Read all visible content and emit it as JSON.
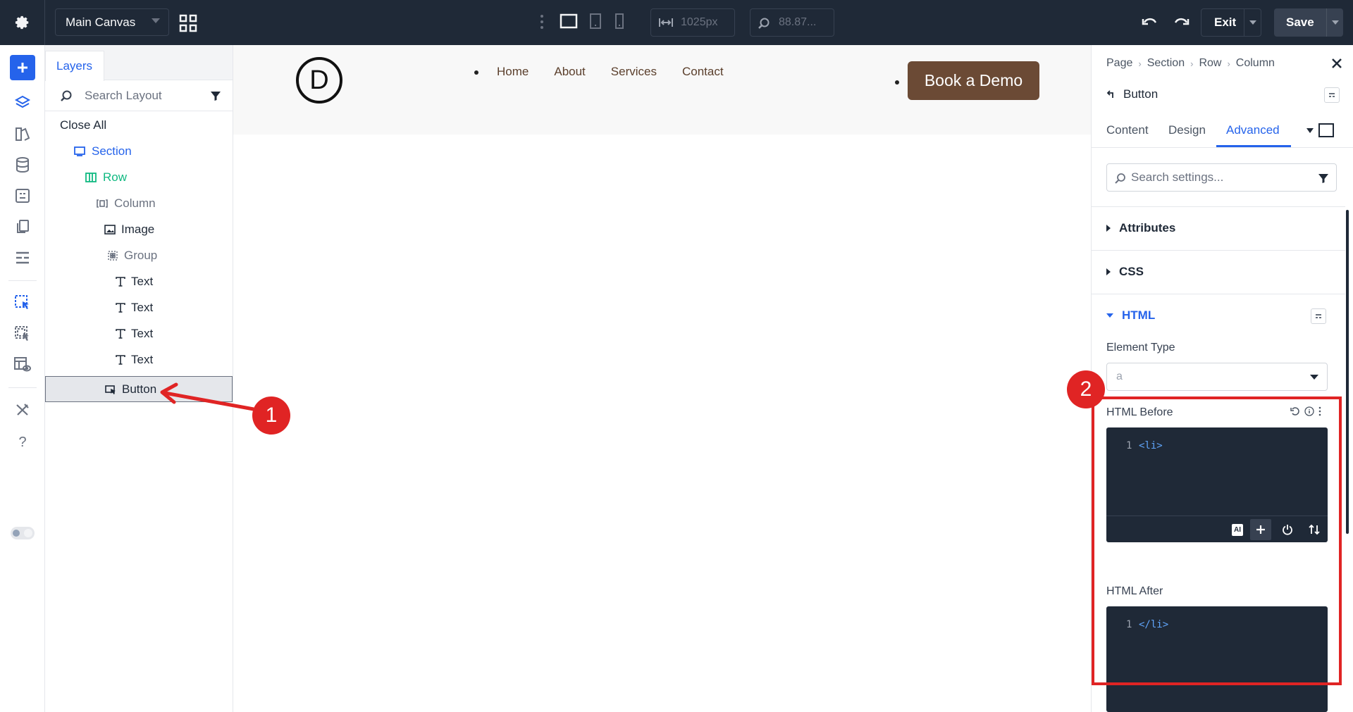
{
  "topbar": {
    "canvas_name": "Main Canvas",
    "width_value": "1025px",
    "zoom_value": "88.87...",
    "exit_label": "Exit",
    "save_label": "Save"
  },
  "layers": {
    "tab_label": "Layers",
    "search_placeholder": "Search Layout",
    "close_all": "Close All",
    "items": [
      {
        "label": "Section",
        "icon": "section-icon"
      },
      {
        "label": "Row",
        "icon": "row-icon"
      },
      {
        "label": "Column",
        "icon": "column-icon"
      },
      {
        "label": "Image",
        "icon": "image-icon"
      },
      {
        "label": "Group",
        "icon": "group-icon"
      },
      {
        "label": "Text",
        "icon": "text-icon"
      },
      {
        "label": "Text",
        "icon": "text-icon"
      },
      {
        "label": "Text",
        "icon": "text-icon"
      },
      {
        "label": "Text",
        "icon": "text-icon"
      },
      {
        "label": "Button",
        "icon": "button-icon",
        "selected": true
      }
    ],
    "colors": {
      "section": "#2563eb",
      "row": "#10b981",
      "muted": "#6b7280"
    }
  },
  "canvas": {
    "logo_letter": "D",
    "nav": [
      "Home",
      "About",
      "Services",
      "Contact"
    ],
    "cta": "Book a Demo",
    "cta_color": "#6b4a35"
  },
  "settings": {
    "breadcrumb": [
      "Page",
      "Section",
      "Row",
      "Column"
    ],
    "module_title": "Button",
    "tabs": [
      "Content",
      "Design",
      "Advanced"
    ],
    "active_tab": "Advanced",
    "search_placeholder": "Search settings...",
    "sections": {
      "attributes": "Attributes",
      "css": "CSS",
      "html": "HTML"
    },
    "element_type_label": "Element Type",
    "element_type_value": "a",
    "html_before_label": "HTML Before",
    "html_before_code": {
      "line": "1",
      "text": "<li>"
    },
    "html_after_label": "HTML After",
    "html_after_code": {
      "line": "1",
      "text": "</li>"
    },
    "ai_label": "AI"
  },
  "annotations": {
    "badge1": "1",
    "badge2": "2",
    "color": "#e02424"
  }
}
